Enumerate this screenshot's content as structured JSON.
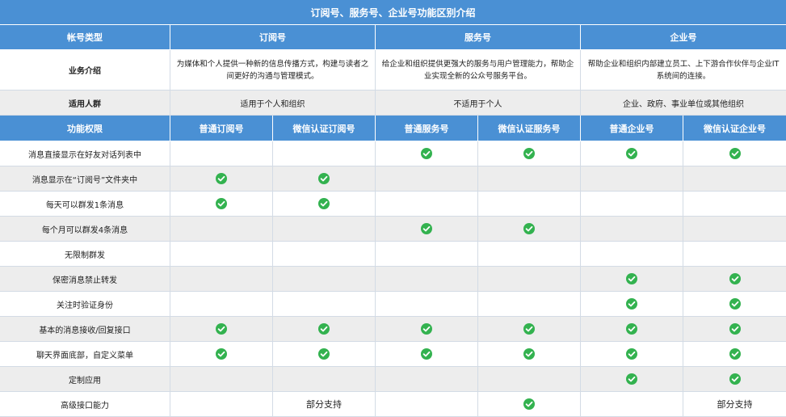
{
  "title": "订阅号、服务号、企业号功能区别介绍",
  "account_types": {
    "label": "帐号类型",
    "subscription": "订阅号",
    "service": "服务号",
    "enterprise": "企业号"
  },
  "business_intro": {
    "label": "业务介绍",
    "subscription": "为媒体和个人提供一种新的信息传播方式，构建与读者之间更好的沟通与管理模式。",
    "service": "给企业和组织提供更强大的服务与用户管理能力，帮助企业实现全新的公众号服务平台。",
    "enterprise": "帮助企业和组织内部建立员工、上下游合作伙伴与企业IT系统间的连接。"
  },
  "audience": {
    "label": "适用人群",
    "subscription": "适用于个人和组织",
    "service": "不适用于个人",
    "enterprise": "企业、政府、事业单位或其他组织"
  },
  "feature_header": {
    "label": "功能权限",
    "columns": [
      "普通订阅号",
      "微信认证订阅号",
      "普通服务号",
      "微信认证服务号",
      "普通企业号",
      "微信认证企业号"
    ]
  },
  "features": [
    {
      "name": "消息直接显示在好友对话列表中",
      "cells": [
        "",
        "",
        "check",
        "check",
        "check",
        "check"
      ]
    },
    {
      "name": "消息显示在“订阅号”文件夹中",
      "cells": [
        "check",
        "check",
        "",
        "",
        "",
        ""
      ]
    },
    {
      "name": "每天可以群发1条消息",
      "cells": [
        "check",
        "check",
        "",
        "",
        "",
        ""
      ]
    },
    {
      "name": "每个月可以群发4条消息",
      "cells": [
        "",
        "",
        "check",
        "check",
        "",
        ""
      ]
    },
    {
      "name": "无限制群发",
      "cells": [
        "",
        "",
        "",
        "",
        "",
        ""
      ]
    },
    {
      "name": "保密消息禁止转发",
      "cells": [
        "",
        "",
        "",
        "",
        "check",
        "check"
      ]
    },
    {
      "name": "关注时验证身份",
      "cells": [
        "",
        "",
        "",
        "",
        "check",
        "check"
      ]
    },
    {
      "name": "基本的消息接收/回复接口",
      "cells": [
        "check",
        "check",
        "check",
        "check",
        "check",
        "check"
      ]
    },
    {
      "name": "聊天界面底部，自定义菜单",
      "cells": [
        "check",
        "check",
        "check",
        "check",
        "check",
        "check"
      ]
    },
    {
      "name": "定制应用",
      "cells": [
        "",
        "",
        "",
        "",
        "check",
        "check"
      ]
    },
    {
      "name": "高级接口能力",
      "cells": [
        "",
        "部分支持",
        "",
        "check",
        "",
        "部分支持"
      ]
    }
  ],
  "colors": {
    "header_blue": "#4a90d4",
    "check_green": "#33b24f",
    "row_gray": "#ededed"
  }
}
